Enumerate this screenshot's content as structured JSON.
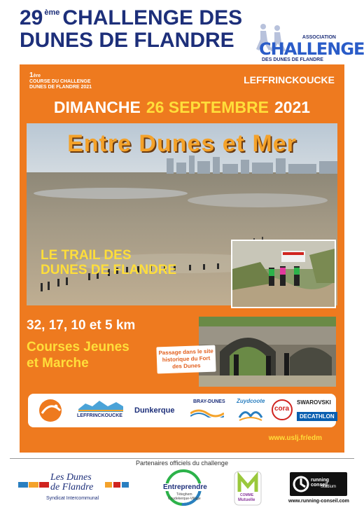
{
  "header": {
    "edition_number": "29",
    "edition_suffix": "ème",
    "title_line1": "CHALLENGE DES",
    "title_line2": "DUNES DE FLANDRE",
    "assoc_small": "ASSOCIATION",
    "assoc_name": "CHALLENGE",
    "assoc_sub": "DES DUNES DE FLANDRE"
  },
  "poster": {
    "first_num": "1",
    "first_sup": "ère",
    "first_line1": "COURSE DU CHALLENGE",
    "first_line2": "DUNES DE FLANDRE 2021",
    "city": "LEFFRINCKOUCKE",
    "date_day": "DIMANCHE",
    "date_date": "26 SEPTEMBRE",
    "date_year": "2021",
    "tagline": "Entre Dunes et Mer",
    "trail_line1": "LE TRAIL DES",
    "trail_line2": "DUNES DE FLANDRE",
    "distances": "32, 17, 10 et 5 km",
    "jeunes_line1": "Courses Jeunes",
    "jeunes_line2": "et Marche",
    "fort_note": "Passage dans le site historique du Fort des Dunes",
    "website": "www.uslj.fr/edm"
  },
  "sponsors": {
    "leffrinckoucke": "LEFFRINCKOUCKE",
    "dunkerque": "Dunkerque",
    "bray": "BRAY-DUNES",
    "zuydcoote": "Zuydcoote",
    "cora": "cora",
    "swarovski": "SWAROVSKI",
    "decathlon": "DECATHLON"
  },
  "footer": {
    "caption": "Partenaires officiels du challenge",
    "dunes_line1": "Les Dunes",
    "dunes_line2": "de Flandre",
    "dunes_sub": "Syndicat Intercommunal",
    "entreprendre": "Entreprendre",
    "entreprendre_sub1": "Téteghem",
    "entreprendre_sub2": "Coudekerque-Village",
    "mutuelle_line1": "COMME",
    "mutuelle_line2": "Mutuelle",
    "running_line1": "running conseil",
    "running_line2": "Stadium",
    "running_url": "www.running-conseil.com"
  },
  "colors": {
    "orange": "#ee7a1f",
    "yellow": "#ffde3a",
    "navy": "#1d2f7a"
  }
}
